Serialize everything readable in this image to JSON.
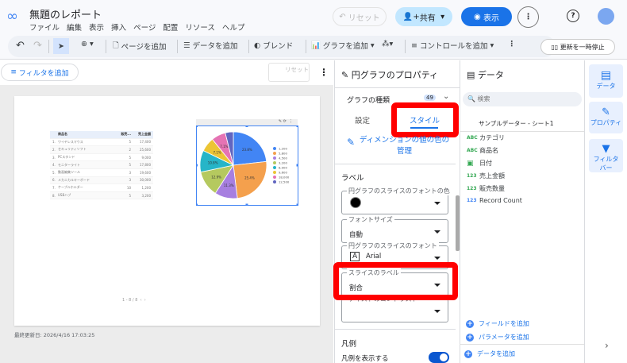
{
  "header": {
    "title": "無題のレポート",
    "menu": [
      "ファイル",
      "編集",
      "表示",
      "挿入",
      "ページ",
      "配置",
      "リソース",
      "ヘルプ"
    ],
    "reset": "リセット",
    "share": "共有",
    "view": "表示"
  },
  "toolbar": {
    "add_page": "ページを追加",
    "add_data": "データを追加",
    "blend": "ブレンド",
    "add_chart": "グラフを追加",
    "add_control": "コントロールを追加",
    "pause": "更新を一時停止"
  },
  "filterbar": {
    "add_filter": "フィルタを追加",
    "reset": "リセット"
  },
  "table": {
    "headers": [
      "商品名",
      "販売...",
      "売上金額"
    ],
    "rows": [
      [
        "1.",
        "ワイヤレスマウス",
        "5",
        "17,400"
      ],
      [
        "2.",
        "セキュリティソフト",
        "2",
        "25,600"
      ],
      [
        "3.",
        "PCスタンド",
        "5",
        "9,000"
      ],
      [
        "4.",
        "モニターライト",
        "5",
        "17,800"
      ],
      [
        "5.",
        "動画編集ツール",
        "3",
        "19,600"
      ],
      [
        "6.",
        "メカニカルキーボード",
        "3",
        "30,000"
      ],
      [
        "7.",
        "ケーブルホルダー",
        "10",
        "1,200"
      ],
      [
        "8.",
        "USBハブ",
        "5",
        "3,200"
      ]
    ],
    "pagination": "1 - 8 / 8"
  },
  "chart_data": {
    "type": "pie",
    "labels": [
      "1,200",
      "5,800",
      "4,500",
      "3,200",
      "8,900",
      "9,600",
      "18,000",
      "12,500"
    ],
    "values": [
      23.8,
      25.4,
      11.3,
      12.9,
      10.8,
      7.1,
      7.1,
      4.0
    ],
    "slice_labels": [
      "23.8%",
      "25.4%",
      "11.3%",
      "12.9%",
      "10.8%",
      "7.1%",
      "7.1%",
      ""
    ],
    "colors": [
      "#4285f4",
      "#f4a04d",
      "#a77fe0",
      "#b5c95f",
      "#26b5c8",
      "#ecc534",
      "#e573b4",
      "#6165c0"
    ],
    "legend": "right"
  },
  "footer": {
    "last_updated": "最終更新日: 2026/4/16 17:03:25"
  },
  "props": {
    "title": "円グラフのプロパティ",
    "chart_type": "グラフの種類",
    "badge": "49",
    "tab_setup": "設定",
    "tab_style": "スタイル",
    "manage_colors": "ディメンションの値の色の管理",
    "label_section": "ラベル",
    "font_color": "円グラフのスライスのフォントの色",
    "font_size": "フォントサイズ",
    "font_size_val": "自動",
    "font": "円グラフのスライスのフォント",
    "font_val": "Arial",
    "slice_label": "スライスのラベル",
    "slice_label_val": "割合",
    "contrast": "テキストのコントラスト",
    "legend_section": "凡例",
    "show_legend": "凡例を表示する",
    "show_legend_on": true
  },
  "data": {
    "title": "データ",
    "search": "検索",
    "source": "サンプルデーター - シート1",
    "fields": [
      {
        "type": "ABC",
        "name": "カテゴリ"
      },
      {
        "type": "ABC",
        "name": "商品名"
      },
      {
        "type": "date",
        "name": "日付"
      },
      {
        "type": "123",
        "name": "売上金額"
      },
      {
        "type": "123",
        "name": "販売数量"
      },
      {
        "type": "123",
        "name": "Record Count"
      }
    ],
    "add_field": "フィールドを追加",
    "add_param": "パラメータを追加",
    "add_data": "データを追加"
  },
  "rail": {
    "data": "データ",
    "props": "プロパティ",
    "filter": "フィルタバー"
  }
}
